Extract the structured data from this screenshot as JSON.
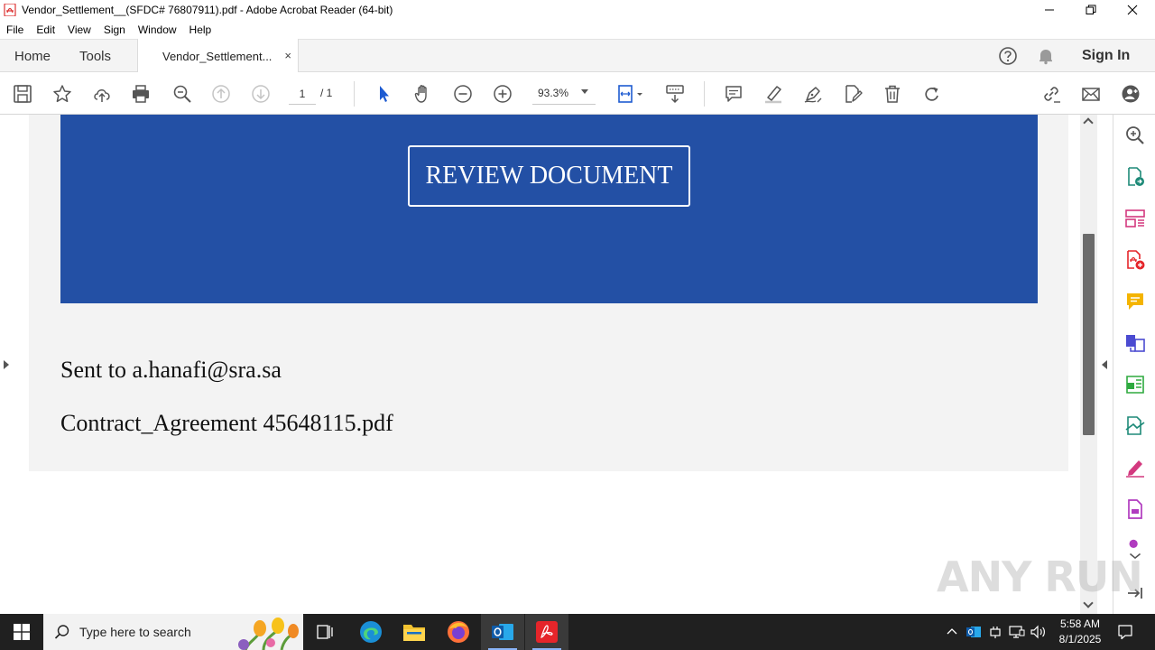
{
  "window": {
    "title": "Vendor_Settlement__(SFDC# 76807911).pdf - Adobe Acrobat Reader (64-bit)"
  },
  "menu": [
    "File",
    "Edit",
    "View",
    "Sign",
    "Window",
    "Help"
  ],
  "tabs": {
    "home": "Home",
    "tools": "Tools",
    "document": "Vendor_Settlement...",
    "close": "×"
  },
  "account": {
    "sign_in": "Sign In"
  },
  "toolbar": {
    "page_current": "1",
    "page_total": "/ 1",
    "zoom": "93.3%"
  },
  "document": {
    "button_label": "REVIEW DOCUMENT",
    "sent_to": "Sent to a.hanafi@sra.sa",
    "file_name": "Contract_Agreement 45648115.pdf",
    "banner_color": "#2350a5"
  },
  "watermark": "ANY RUN",
  "taskbar": {
    "search_placeholder": "Type here to search",
    "time": "5:58 AM",
    "date": "8/1/2025"
  },
  "colors": {
    "accent": "#2350a5",
    "acrobat_red": "#e5252a",
    "taskbar": "#202020"
  }
}
